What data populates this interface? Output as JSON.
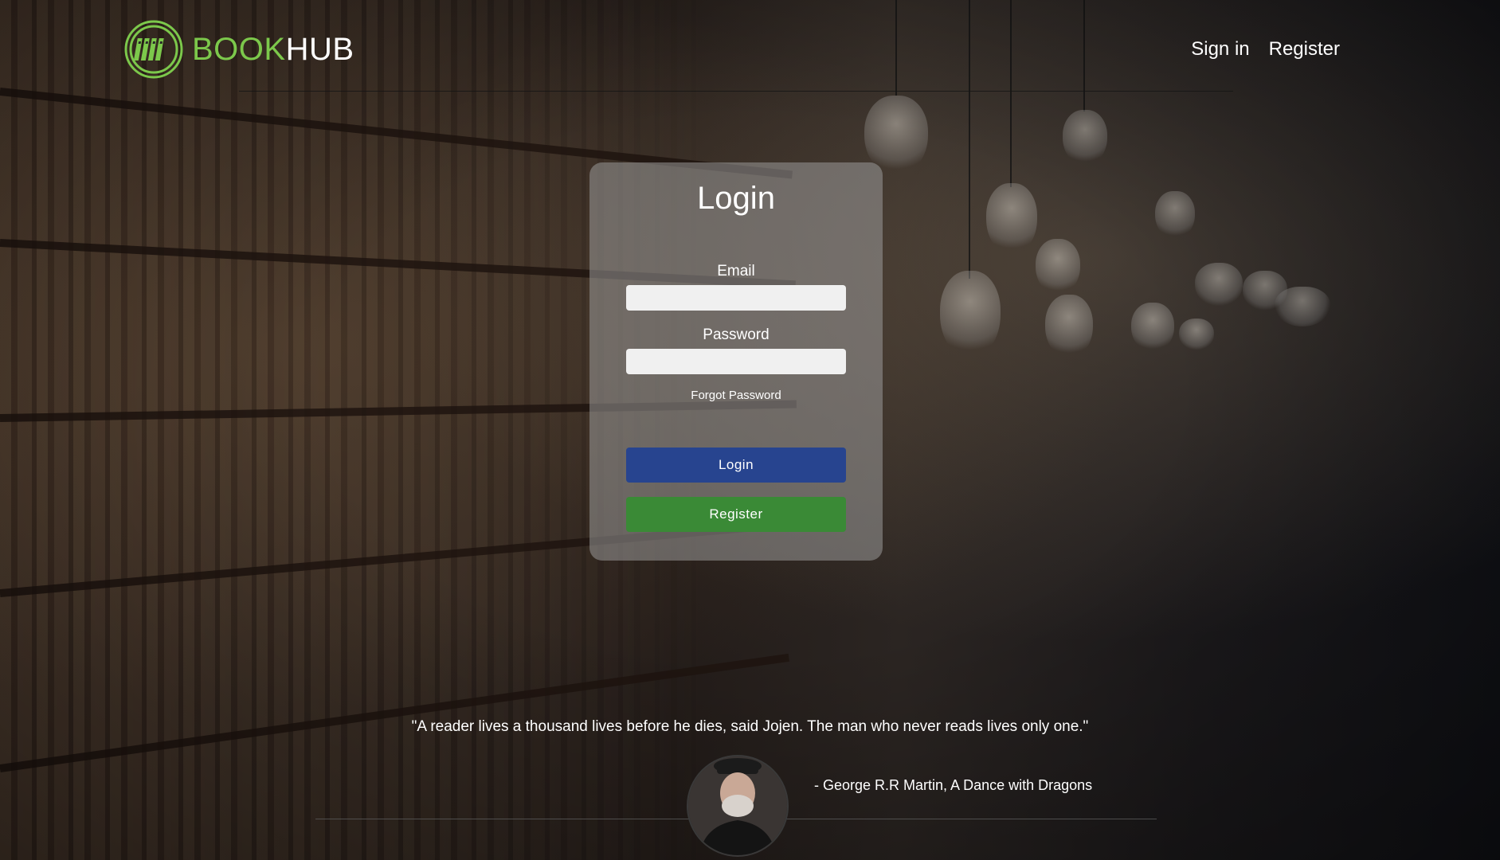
{
  "brand": {
    "name_part1": "BOOK",
    "name_part2": "HUB",
    "accent_color": "#7cc84b"
  },
  "nav": {
    "items": [
      {
        "label": "Sign in"
      },
      {
        "label": "Register"
      }
    ]
  },
  "login_card": {
    "title": "Login",
    "email_label": "Email",
    "email_value": "",
    "password_label": "Password",
    "password_value": "",
    "forgot_link": "Forgot Password",
    "login_button": "Login",
    "register_button": "Register",
    "login_button_color": "#27448f",
    "register_button_color": "#3a8a36"
  },
  "quote": {
    "text": "\"A reader lives a thousand lives before he dies, said Jojen. The man who never reads lives only one.\"",
    "attribution": "- George R.R Martin, A Dance with Dragons"
  },
  "icons": {
    "logo": "books-circle-icon",
    "author_photo": "author-avatar"
  }
}
